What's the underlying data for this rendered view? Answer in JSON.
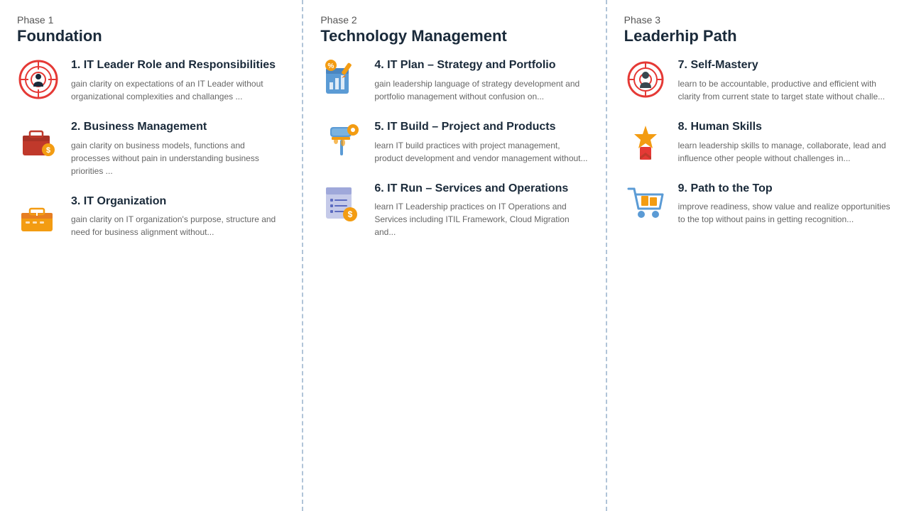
{
  "phases": [
    {
      "id": "phase1",
      "label": "Phase 1",
      "title": "Foundation",
      "partial": "left",
      "courses": [
        {
          "id": "course1",
          "title": "1. IT Leader Role and Responsibilities",
          "desc": "gain clarity on expectations of an IT Leader without organizational complexities and challanges ...",
          "icon": "target"
        },
        {
          "id": "course2",
          "title": "2. Business Management",
          "desc": "gain clarity on business models, functions and processes without pain in understanding business priorities ...",
          "icon": "briefcase"
        },
        {
          "id": "course3",
          "title": "3. IT Organization",
          "desc": "gain clarity on IT organization's purpose, structure and need for business alignment without...",
          "icon": "toolbox"
        }
      ]
    },
    {
      "id": "phase2",
      "label": "Phase 2",
      "title": "Technology Management",
      "partial": "middle",
      "courses": [
        {
          "id": "course4",
          "title": "4. IT Plan – Strategy and Portfolio",
          "desc": "gain leadership language of strategy development and portfolio management without confusion on...",
          "icon": "chart-strategy"
        },
        {
          "id": "course5",
          "title": "5. IT Build – Project and Products",
          "desc": "learn IT build practices with project management, product development and vendor management without...",
          "icon": "build"
        },
        {
          "id": "course6",
          "title": "6. IT Run – Services and Operations",
          "desc": "learn IT Leadership practices on IT Operations and Services including ITIL Framework, Cloud Migration and...",
          "icon": "run-services"
        }
      ]
    },
    {
      "id": "phase3",
      "label": "Phase 3",
      "title": "Leaderhip Path",
      "partial": "right",
      "courses": [
        {
          "id": "course7",
          "title": "7. Self-Mastery",
          "desc": "learn to be accountable, productive and efficient with clarity from current state to target state without challe...",
          "icon": "self-mastery"
        },
        {
          "id": "course8",
          "title": "8. Human Skills",
          "desc": "learn leadership skills to manage, collaborate, lead and influence other people without challenges in...",
          "icon": "award"
        },
        {
          "id": "course9",
          "title": "9. Path to the Top",
          "desc": "improve readiness, show value and realize opportunities to the top without pains in getting recognition...",
          "icon": "cart"
        }
      ]
    }
  ]
}
